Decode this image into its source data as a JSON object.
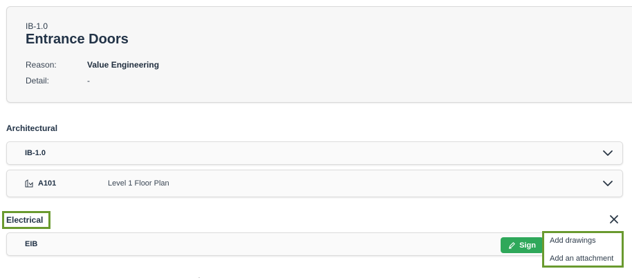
{
  "header": {
    "code": "IB-1.0",
    "title": "Entrance Doors",
    "reason_label": "Reason:",
    "reason_value": "Value Engineering",
    "detail_label": "Detail:",
    "detail_value": "-"
  },
  "sections": {
    "architectural": {
      "heading": "Architectural",
      "rows": [
        {
          "code": "IB-1.0",
          "description": ""
        },
        {
          "code": "A101",
          "description": "Level 1 Floor Plan"
        }
      ]
    },
    "electrical": {
      "heading": "Electrical",
      "rows": [
        {
          "code": "EIB",
          "sign_label": "Sign"
        }
      ]
    }
  },
  "menu": {
    "items": [
      {
        "label": "Add drawings"
      },
      {
        "label": "Add an attachment"
      }
    ]
  },
  "icons": {
    "chevron": "chevron-down-icon",
    "close": "close-icon",
    "drawing": "drawing-icon",
    "sign": "pen-icon"
  },
  "colors": {
    "accent_green": "#2fa85a",
    "highlight_green": "#6a9a2f",
    "title_navy": "#223347"
  }
}
